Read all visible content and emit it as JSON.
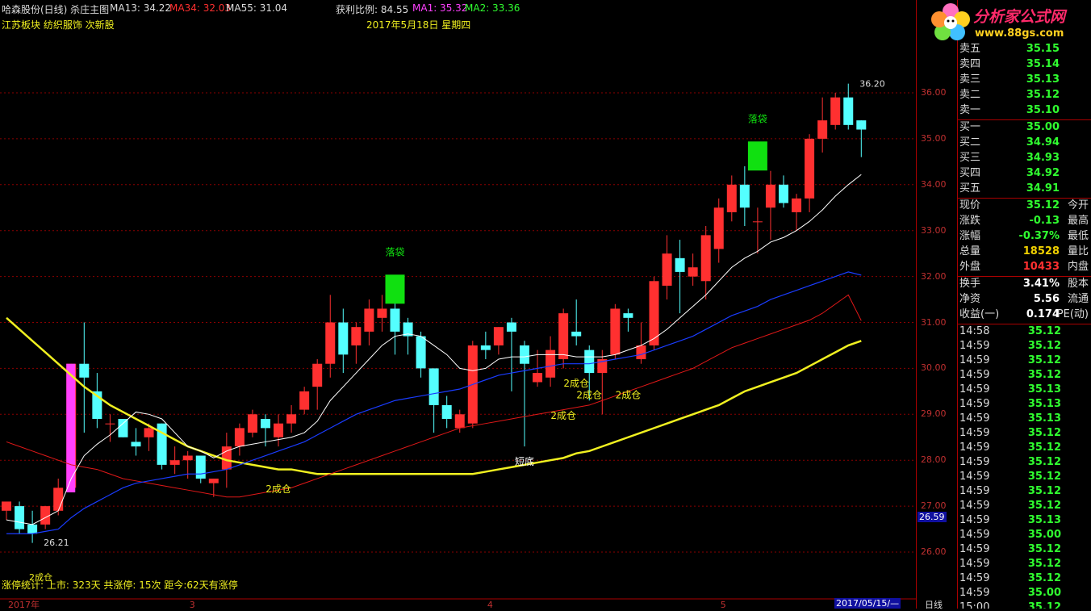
{
  "header": {
    "stock_title": "哈森股份(日线) 杀庄主图",
    "ma13": "MA13: 34.22",
    "ma34": "MA34: 32.03",
    "ma55": "MA55: 31.04",
    "profit_ratio": "获利比例: 84.55",
    "ma1": "MA1: 35.32",
    "ma2": "MA2: 33.36",
    "sector_tags": "江苏板块 纺织服饰 次新股",
    "date_label": "2017年5月18日  星期四"
  },
  "logo": {
    "name": "分析家公式网",
    "url_text": "www.88gs.com"
  },
  "colors": {
    "up": "#ff3030",
    "down": "#54ffff",
    "ma13": "#ffffff",
    "ma34": "#1a3cff",
    "ma55": "#e01818",
    "ma_long": "#f0f020",
    "signal_green": "#10e010",
    "spike_magenta": "#ff40ff",
    "grid": "#8b0000"
  },
  "chart_data": {
    "type": "candlestick",
    "ylim": [
      25.7,
      36.95
    ],
    "y_ticks": [
      "36.00",
      "35.00",
      "34.00",
      "33.00",
      "32.00",
      "31.00",
      "30.00",
      "29.00",
      "28.00",
      "27.00",
      "26.00"
    ],
    "x_labels": [
      {
        "i": 0,
        "text": "2017年"
      },
      {
        "i": 14,
        "text": "3"
      },
      {
        "i": 37,
        "text": "4"
      },
      {
        "i": 55,
        "text": "5"
      }
    ],
    "candles": [
      [
        26.9,
        27.1,
        27.0,
        26.7
      ],
      [
        27.0,
        26.5,
        27.1,
        26.4
      ],
      [
        26.6,
        26.4,
        26.9,
        26.2
      ],
      [
        26.6,
        27.0,
        27.0,
        26.5
      ],
      [
        26.9,
        27.4,
        27.6,
        26.8
      ],
      [
        27.4,
        30.1,
        30.1,
        27.3
      ],
      [
        30.1,
        29.8,
        31.0,
        28.6
      ],
      [
        29.5,
        28.9,
        29.9,
        28.7
      ],
      [
        28.8,
        28.8,
        29.0,
        28.4
      ],
      [
        28.9,
        28.5,
        28.9,
        28.5
      ],
      [
        28.4,
        28.3,
        28.7,
        28.1
      ],
      [
        28.5,
        28.7,
        28.8,
        28.2
      ],
      [
        28.8,
        27.9,
        28.8,
        27.8
      ],
      [
        27.9,
        28.0,
        28.3,
        27.7
      ],
      [
        28.0,
        28.1,
        28.2,
        27.6
      ],
      [
        28.1,
        27.6,
        28.1,
        27.5
      ],
      [
        27.5,
        27.6,
        27.6,
        27.2
      ],
      [
        27.8,
        28.3,
        28.6,
        27.4
      ],
      [
        28.3,
        28.7,
        28.8,
        28.1
      ],
      [
        28.6,
        29.0,
        29.1,
        28.5
      ],
      [
        28.9,
        28.7,
        29.0,
        28.3
      ],
      [
        28.5,
        28.8,
        29.0,
        28.3
      ],
      [
        28.8,
        29.0,
        29.2,
        28.6
      ],
      [
        29.1,
        29.5,
        29.6,
        29.0
      ],
      [
        29.6,
        30.1,
        30.2,
        29.1
      ],
      [
        30.1,
        31.0,
        31.6,
        29.8
      ],
      [
        31.0,
        30.3,
        31.3,
        29.9
      ],
      [
        30.5,
        30.9,
        31.0,
        30.1
      ],
      [
        30.8,
        31.3,
        31.5,
        30.5
      ],
      [
        31.1,
        31.3,
        31.6,
        30.8
      ],
      [
        31.3,
        30.8,
        31.5,
        30.3
      ],
      [
        31.0,
        30.7,
        31.1,
        30.3
      ],
      [
        30.7,
        30.0,
        30.8,
        29.8
      ],
      [
        30.0,
        29.2,
        30.0,
        28.6
      ],
      [
        29.2,
        28.9,
        29.4,
        28.7
      ],
      [
        28.7,
        29.0,
        29.1,
        28.6
      ],
      [
        28.8,
        30.5,
        30.6,
        28.7
      ],
      [
        30.5,
        30.4,
        30.8,
        30.2
      ],
      [
        30.5,
        30.9,
        30.9,
        30.3
      ],
      [
        31.0,
        30.8,
        31.1,
        29.5
      ],
      [
        30.5,
        30.1,
        30.6,
        28.3
      ],
      [
        29.7,
        29.9,
        30.4,
        29.6
      ],
      [
        29.8,
        30.4,
        30.7,
        29.6
      ],
      [
        30.2,
        31.2,
        31.3,
        30.0
      ],
      [
        30.8,
        30.7,
        31.5,
        30.5
      ],
      [
        30.4,
        29.9,
        30.5,
        29.3
      ],
      [
        29.9,
        30.2,
        30.4,
        29.0
      ],
      [
        30.3,
        31.3,
        31.4,
        30.2
      ],
      [
        31.2,
        31.1,
        31.3,
        30.8
      ],
      [
        30.2,
        30.5,
        31.0,
        30.1
      ],
      [
        30.5,
        31.9,
        32.0,
        30.4
      ],
      [
        31.8,
        32.5,
        32.9,
        31.5
      ],
      [
        32.4,
        32.1,
        32.8,
        31.2
      ],
      [
        32.0,
        32.2,
        32.5,
        31.8
      ],
      [
        31.9,
        32.9,
        33.1,
        31.5
      ],
      [
        32.6,
        33.5,
        33.7,
        32.3
      ],
      [
        33.4,
        34.0,
        34.2,
        33.2
      ],
      [
        34.0,
        33.5,
        34.4,
        33.1
      ],
      [
        33.2,
        33.2,
        33.5,
        32.5
      ],
      [
        33.5,
        34.0,
        34.3,
        32.8
      ],
      [
        34.0,
        33.6,
        34.2,
        33.5
      ],
      [
        33.4,
        33.7,
        33.8,
        33.0
      ],
      [
        33.7,
        35.0,
        35.1,
        33.4
      ],
      [
        35.0,
        35.4,
        35.9,
        34.7
      ],
      [
        35.3,
        35.9,
        36.0,
        35.2
      ],
      [
        35.9,
        35.3,
        36.2,
        35.2
      ],
      [
        35.4,
        35.2,
        35.4,
        34.6
      ]
    ],
    "ma13": [
      26.7,
      26.65,
      26.6,
      26.75,
      26.9,
      27.6,
      28.1,
      28.35,
      28.55,
      28.8,
      29.05,
      29.0,
      28.9,
      28.6,
      28.3,
      28.2,
      28.05,
      28.2,
      28.3,
      28.35,
      28.4,
      28.45,
      28.5,
      28.6,
      28.85,
      29.3,
      29.6,
      29.9,
      30.2,
      30.5,
      30.7,
      30.75,
      30.7,
      30.5,
      30.3,
      30.0,
      29.95,
      30.0,
      30.2,
      30.25,
      30.25,
      30.3,
      30.3,
      30.3,
      30.25,
      30.25,
      30.25,
      30.3,
      30.4,
      30.5,
      30.65,
      30.85,
      31.1,
      31.35,
      31.6,
      31.9,
      32.2,
      32.4,
      32.55,
      32.75,
      32.85,
      33.0,
      33.2,
      33.45,
      33.75,
      34.0,
      34.22
    ],
    "ma34": [
      26.4,
      26.4,
      26.4,
      26.45,
      26.5,
      26.75,
      26.95,
      27.1,
      27.25,
      27.4,
      27.5,
      27.55,
      27.6,
      27.65,
      27.7,
      27.7,
      27.75,
      27.8,
      27.9,
      28.0,
      28.1,
      28.2,
      28.3,
      28.4,
      28.55,
      28.7,
      28.85,
      29.0,
      29.1,
      29.2,
      29.3,
      29.35,
      29.4,
      29.45,
      29.5,
      29.55,
      29.65,
      29.75,
      29.85,
      29.9,
      29.95,
      30.0,
      30.05,
      30.1,
      30.1,
      30.1,
      30.15,
      30.2,
      30.25,
      30.3,
      30.4,
      30.5,
      30.6,
      30.7,
      30.85,
      31.0,
      31.15,
      31.25,
      31.35,
      31.5,
      31.6,
      31.7,
      31.8,
      31.9,
      32.0,
      32.1,
      32.03
    ],
    "ma55": [
      28.4,
      28.3,
      28.2,
      28.1,
      28.0,
      27.9,
      27.85,
      27.8,
      27.7,
      27.6,
      27.55,
      27.5,
      27.45,
      27.4,
      27.35,
      27.3,
      27.25,
      27.2,
      27.2,
      27.25,
      27.3,
      27.35,
      27.4,
      27.5,
      27.6,
      27.7,
      27.8,
      27.9,
      28.0,
      28.1,
      28.2,
      28.3,
      28.4,
      28.5,
      28.6,
      28.7,
      28.75,
      28.8,
      28.85,
      28.9,
      28.95,
      29.0,
      29.05,
      29.1,
      29.15,
      29.2,
      29.3,
      29.4,
      29.5,
      29.6,
      29.7,
      29.8,
      29.9,
      30.0,
      30.15,
      30.3,
      30.45,
      30.55,
      30.65,
      30.75,
      30.85,
      30.95,
      31.05,
      31.2,
      31.4,
      31.6,
      31.04
    ],
    "ma_long": [
      31.1,
      30.85,
      30.6,
      30.35,
      30.1,
      29.85,
      29.6,
      29.4,
      29.2,
      29.05,
      28.9,
      28.75,
      28.6,
      28.45,
      28.3,
      28.2,
      28.1,
      28.0,
      27.95,
      27.9,
      27.85,
      27.8,
      27.8,
      27.75,
      27.7,
      27.7,
      27.7,
      27.7,
      27.7,
      27.7,
      27.7,
      27.7,
      27.7,
      27.7,
      27.7,
      27.7,
      27.7,
      27.75,
      27.8,
      27.85,
      27.9,
      27.95,
      28.0,
      28.05,
      28.15,
      28.2,
      28.3,
      28.4,
      28.5,
      28.6,
      28.7,
      28.8,
      28.9,
      29.0,
      29.1,
      29.2,
      29.35,
      29.5,
      29.6,
      29.7,
      29.8,
      29.9,
      30.05,
      30.2,
      30.35,
      30.5,
      30.6
    ],
    "spike": {
      "i": 5,
      "low": 27.3,
      "high": 30.1
    },
    "signals": [
      {
        "i": 30,
        "text": "落袋",
        "y": 31.9
      },
      {
        "i": 58,
        "text": "落袋",
        "y": 34.8
      }
    ],
    "annotations": [
      {
        "i": 21,
        "text": "2成仓",
        "y": 27.3
      },
      {
        "i": 40,
        "text": "短底",
        "y": 27.9
      },
      {
        "i": 43,
        "text": "2成仓",
        "y": 28.9
      },
      {
        "i": 44,
        "text": "2成仓",
        "y": 29.6
      },
      {
        "i": 45,
        "text": "2成仓",
        "y": 29.35
      },
      {
        "i": 48,
        "text": "2成仓",
        "y": 29.35
      }
    ],
    "price_marks": [
      {
        "i": 65,
        "text": "36.20",
        "y": 36.2
      },
      {
        "i": 2,
        "text": "26.21",
        "y": 26.21
      }
    ],
    "current_price_tag": "26.59"
  },
  "footer": {
    "stats": "涨停统计:  上市: 323天   共涨停: 15次   距今:62天有涨停",
    "stats_note": "2成仓",
    "date_box": "2017/05/15/—",
    "period": "日线"
  },
  "quote": {
    "asks": [
      {
        "label": "卖五",
        "price": "35.15"
      },
      {
        "label": "卖四",
        "price": "35.14"
      },
      {
        "label": "卖三",
        "price": "35.13"
      },
      {
        "label": "卖二",
        "price": "35.12"
      },
      {
        "label": "卖一",
        "price": "35.10"
      }
    ],
    "bids": [
      {
        "label": "买一",
        "price": "35.00"
      },
      {
        "label": "买二",
        "price": "34.94"
      },
      {
        "label": "买三",
        "price": "34.93"
      },
      {
        "label": "买四",
        "price": "34.92"
      },
      {
        "label": "买五",
        "price": "34.91"
      }
    ],
    "stats": [
      {
        "label": "现价",
        "value": "35.12",
        "color": "#30ff30",
        "label2": "今开"
      },
      {
        "label": "涨跌",
        "value": "-0.13",
        "color": "#30ff30",
        "label2": "最高"
      },
      {
        "label": "涨幅",
        "value": "-0.37%",
        "color": "#30ff30",
        "label2": "最低"
      },
      {
        "label": "总量",
        "value": "18528",
        "color": "#f0d000",
        "label2": "量比"
      },
      {
        "label": "外盘",
        "value": "10433",
        "color": "#ff3030",
        "label2": "内盘"
      }
    ],
    "stats2": [
      {
        "label": "换手",
        "value": "3.41%",
        "color": "#ffffff",
        "label2": "股本"
      },
      {
        "label": "净资",
        "value": "5.56",
        "color": "#ffffff",
        "label2": "流通"
      },
      {
        "label": "收益(一)",
        "value": "0.174",
        "color": "#ffffff",
        "label2": "PE(动)"
      }
    ],
    "ticks": [
      {
        "time": "14:58",
        "price": "35.12"
      },
      {
        "time": "14:59",
        "price": "35.12"
      },
      {
        "time": "14:59",
        "price": "35.12"
      },
      {
        "time": "14:59",
        "price": "35.12"
      },
      {
        "time": "14:59",
        "price": "35.13"
      },
      {
        "time": "14:59",
        "price": "35.13"
      },
      {
        "time": "14:59",
        "price": "35.13"
      },
      {
        "time": "14:59",
        "price": "35.12"
      },
      {
        "time": "14:59",
        "price": "35.12"
      },
      {
        "time": "14:59",
        "price": "35.12"
      },
      {
        "time": "14:59",
        "price": "35.12"
      },
      {
        "time": "14:59",
        "price": "35.12"
      },
      {
        "time": "14:59",
        "price": "35.12"
      },
      {
        "time": "14:59",
        "price": "35.13"
      },
      {
        "time": "14:59",
        "price": "35.00"
      },
      {
        "time": "14:59",
        "price": "35.12"
      },
      {
        "time": "14:59",
        "price": "35.12"
      },
      {
        "time": "14:59",
        "price": "35.12"
      },
      {
        "time": "14:59",
        "price": "35.00"
      },
      {
        "time": "15:00",
        "price": "35.12"
      }
    ]
  }
}
